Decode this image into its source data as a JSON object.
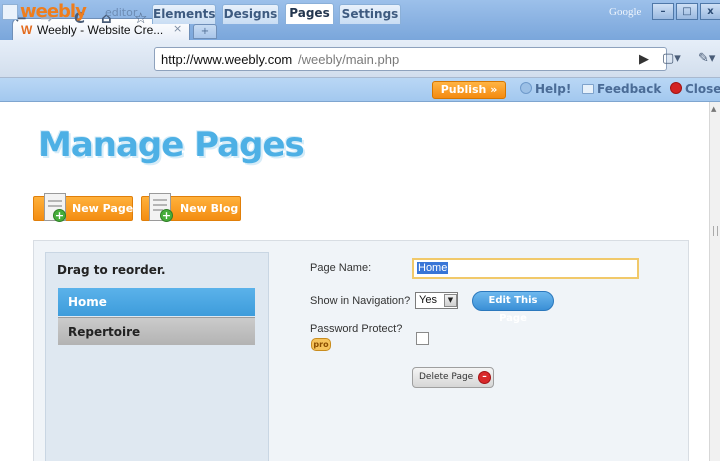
{
  "browser": {
    "tab_logo": "W",
    "tab_title": "Weebly - Website Cre...",
    "tab_close": "×",
    "new_tab": "+",
    "brand": "Google",
    "window_min": "–",
    "window_max": "□",
    "window_close": "x",
    "back": "←",
    "forward": "→",
    "reload": "C",
    "home": "⌂",
    "star": "☆",
    "url_host": "http://www.weebly.com",
    "url_path": "/weebly/main.php",
    "go": "▶",
    "page_menu": "▢▾",
    "tools_menu": "✎▾"
  },
  "editor_bar": {
    "logo": "weebly",
    "logo_sub": "editor",
    "tabs": [
      {
        "label": "Elements"
      },
      {
        "label": "Designs"
      },
      {
        "label": "Pages"
      },
      {
        "label": "Settings"
      }
    ],
    "active_tab": "Pages",
    "publish": "Publish »",
    "help": "Help!",
    "feedback": "Feedback",
    "close": "Close"
  },
  "page": {
    "title": "Manage Pages",
    "new_page": "New Page",
    "new_blog": "New Blog",
    "drag_label": "Drag to reorder.",
    "pages": [
      {
        "label": "Home",
        "selected": true
      },
      {
        "label": "Repertoire",
        "selected": false
      }
    ],
    "form": {
      "page_name_label": "Page Name:",
      "page_name_value": "Home",
      "show_nav_label": "Show in Navigation?",
      "show_nav_value": "Yes",
      "edit_button": "Edit This Page",
      "password_label": "Password Protect?",
      "pro_badge": "pro",
      "password_checked": false,
      "delete_button": "Delete Page"
    }
  },
  "colors": {
    "accent_blue": "#3d9cdb",
    "publish_orange": "#f48a10",
    "heading_blue": "#4db0e5"
  }
}
